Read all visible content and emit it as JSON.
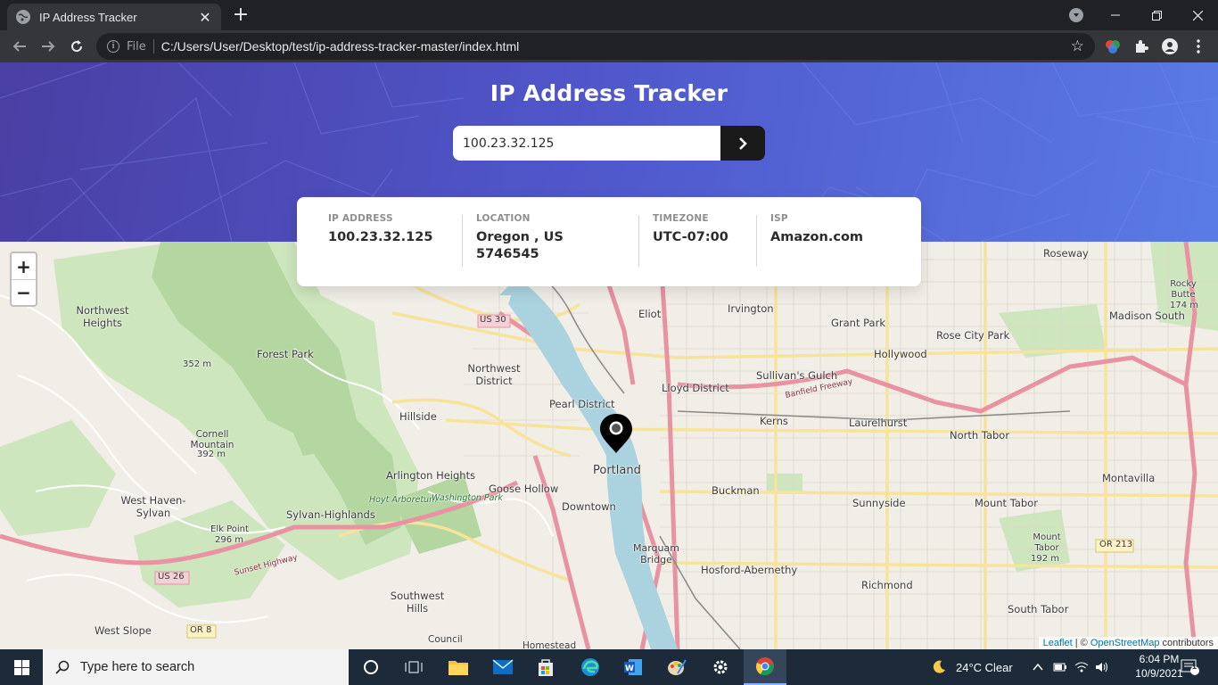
{
  "browser": {
    "tab_title": "IP Address Tracker",
    "tab_close": "✕",
    "new_tab": "+",
    "url_scheme_label": "File",
    "url": "C:/Users/User/Desktop/test/ip-address-tracker-master/index.html"
  },
  "page": {
    "title": "IP Address Tracker",
    "search_value": "100.23.32.125",
    "search_button_icon": "chevron-right-icon",
    "info": [
      {
        "label": "IP ADDRESS",
        "value": "100.23.32.125"
      },
      {
        "label": "LOCATION",
        "value": "Oregon , US 5746545"
      },
      {
        "label": "TIMEZONE",
        "value": "UTC-07:00"
      },
      {
        "label": "ISP",
        "value": "Amazon.com"
      }
    ]
  },
  "map": {
    "zoom_in": "+",
    "zoom_out": "−",
    "attribution_leaflet": "Leaflet",
    "attribution_sep": " | © ",
    "attribution_osm": "OpenStreetMap",
    "attribution_suffix": " contributors",
    "labels": {
      "roseway": "Roseway",
      "northwest_heights": "Northwest Heights",
      "forest_park": "Forest Park",
      "elev_352": "352 m",
      "eliot": "Eliot",
      "irvington": "Irvington",
      "grant_park": "Grant Park",
      "rose_city_park": "Rose City Park",
      "madison_south": "Madison South",
      "rocky_butte": "Rocky Butte",
      "rocky_butte_elev": "174 m",
      "northwest_district": "Northwest District",
      "hollywood": "Hollywood",
      "sullivans_gulch": "Sullivan's Gulch",
      "lloyd_district": "Lloyd District",
      "pearl_district": "Pearl District",
      "hillside": "Hillside",
      "kerns": "Kerns",
      "laurelhurst": "Laurelhurst",
      "north_tabor": "North Tabor",
      "cornell_mountain": "Cornell Mountain",
      "cornell_elev": "392 m",
      "portland": "Portland",
      "arlington_heights": "Arlington Heights",
      "goose_hollow": "Goose Hollow",
      "buckman": "Buckman",
      "montavilla": "Montavilla",
      "west_haven_sylvan": "West Haven-Sylvan",
      "sylvan_highlands": "Sylvan-Highlands",
      "downtown": "Downtown",
      "sunnyside": "Sunnyside",
      "mount_tabor": "Mount Tabor",
      "elk_point": "Elk Point",
      "elk_point_elev": "296 m",
      "mount_tabor_peak": "Mount Tabor",
      "mount_tabor_elev": "192 m",
      "marquam_bridge": "Marquam Bridge",
      "hosford_abernethy": "Hosford-Abernethy",
      "richmond": "Richmond",
      "southwest_hills": "Southwest Hills",
      "south_tabor": "South Tabor",
      "west_slope": "West Slope",
      "council_crest": "Council",
      "us30": "US 30",
      "us26": "US 26",
      "or8": "OR 8",
      "or213": "OR 213",
      "hoyt_arboretum": "Hoyt Arboretum",
      "washington_park": "Washington Park",
      "banfield": "Banfield Freeway",
      "sunset_hwy": "Sunset Highway",
      "homestead": "Homestead"
    }
  },
  "taskbar": {
    "search_placeholder": "Type here to search",
    "weather": "24°C  Clear",
    "time": "6:04 PM",
    "date": "10/9/2021",
    "notifications": "1"
  },
  "colors": {
    "hero_start": "#4a3fa3",
    "hero_end": "#5a7be6",
    "button": "#1a1a1a"
  }
}
